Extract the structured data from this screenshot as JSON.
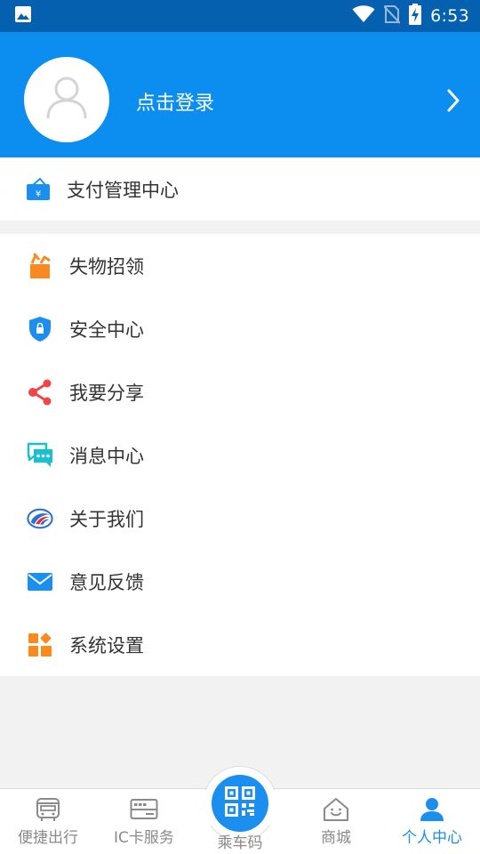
{
  "status_bar": {
    "time": "6:53",
    "icons": [
      "image-icon",
      "wifi-icon",
      "no-sim-icon",
      "battery-charging-icon"
    ]
  },
  "header": {
    "login_text": "点击登录",
    "avatar_icon": "user-placeholder-icon",
    "chevron_icon": "chevron-right-icon",
    "background_color": "#0b8ef0"
  },
  "pay_section": {
    "label": "支付管理中心",
    "icon": "wallet-yen-icon"
  },
  "menu": {
    "items": [
      {
        "label": "失物招领",
        "icon": "lost-found-box-icon"
      },
      {
        "label": "安全中心",
        "icon": "shield-lock-icon"
      },
      {
        "label": "我要分享",
        "icon": "share-icon"
      },
      {
        "label": "消息中心",
        "icon": "chat-bubbles-icon"
      },
      {
        "label": "关于我们",
        "icon": "about-logo-icon"
      },
      {
        "label": "意见反馈",
        "icon": "mail-icon"
      },
      {
        "label": "系统设置",
        "icon": "settings-grid-icon"
      }
    ]
  },
  "tabbar": {
    "tabs": [
      {
        "label": "便捷出行",
        "icon": "bus-icon",
        "active": false
      },
      {
        "label": "IC卡服务",
        "icon": "card-icon",
        "active": false
      },
      {
        "label": "乘车码",
        "icon": "qr-code-icon",
        "active": false
      },
      {
        "label": "商城",
        "icon": "shop-house-icon",
        "active": false
      },
      {
        "label": "个人中心",
        "icon": "person-icon",
        "active": true
      }
    ],
    "active_color": "#1a8ff0",
    "inactive_color": "#8a8a8a"
  }
}
